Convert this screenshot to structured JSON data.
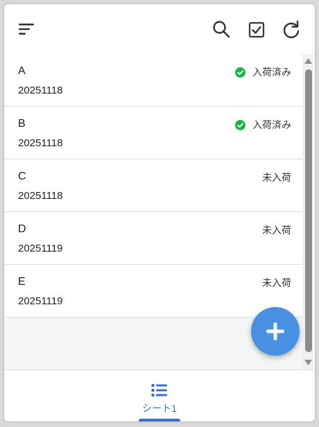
{
  "toolbar": {
    "icons": [
      "sort-icon",
      "search-icon",
      "checkbox-icon",
      "refresh-icon"
    ]
  },
  "items": [
    {
      "title": "A",
      "date": "20251118",
      "status": "入荷済み",
      "received": true
    },
    {
      "title": "B",
      "date": "20251118",
      "status": "入荷済み",
      "received": true
    },
    {
      "title": "C",
      "date": "20251118",
      "status": "未入荷",
      "received": false
    },
    {
      "title": "D",
      "date": "20251119",
      "status": "未入荷",
      "received": false
    },
    {
      "title": "E",
      "date": "20251119",
      "status": "未入荷",
      "received": false
    }
  ],
  "fab": {
    "icon": "plus-icon"
  },
  "bottom_nav": {
    "tab_label": "シート1",
    "tab_icon": "list-icon"
  },
  "colors": {
    "accent": "#4a90e2",
    "tab_active": "#3a6fbf",
    "status_ok": "#1db34a"
  }
}
